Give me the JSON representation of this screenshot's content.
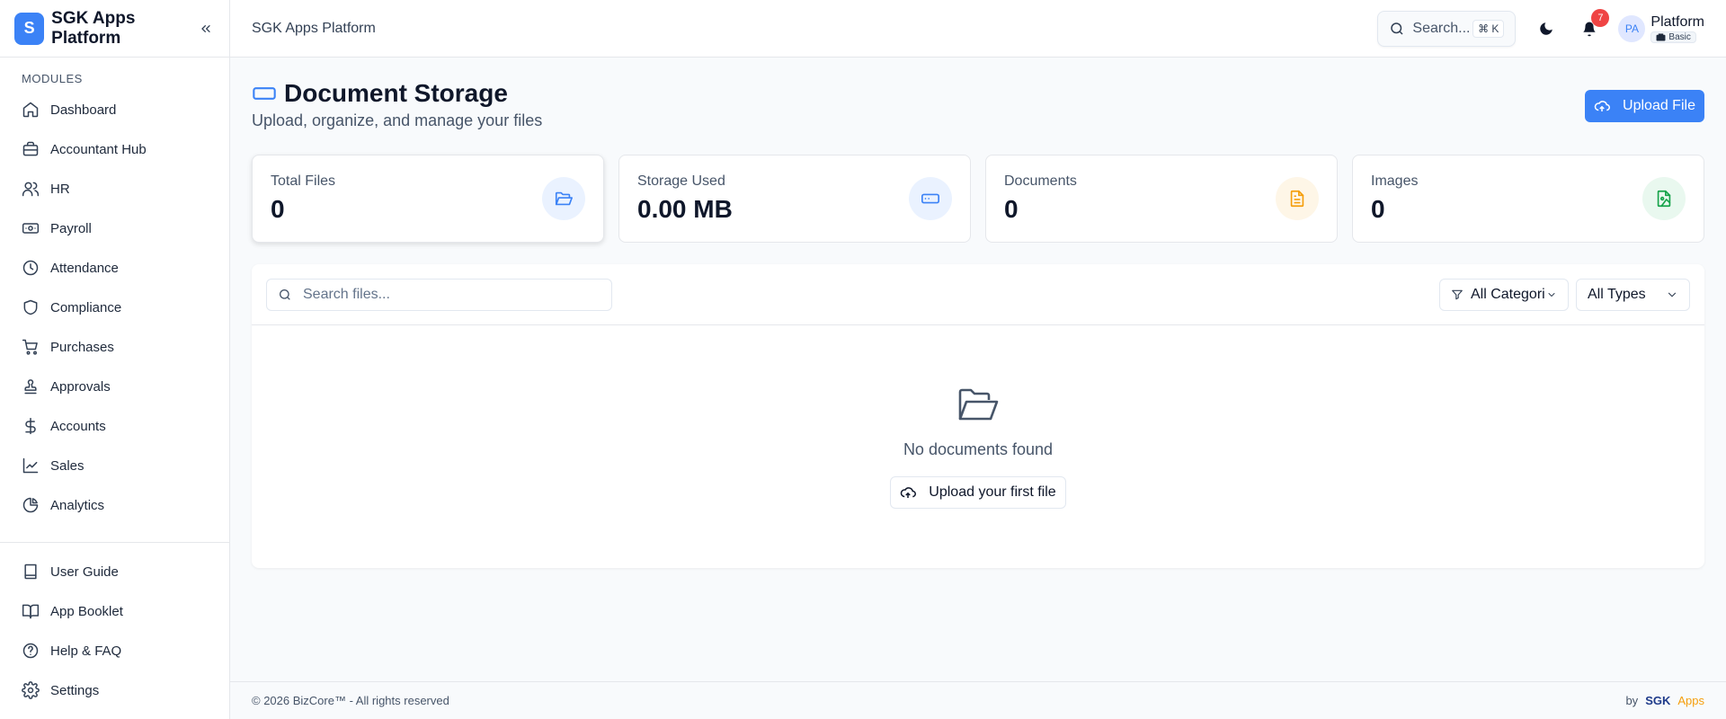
{
  "brand": {
    "logo_letter": "S",
    "name": "SGK Apps Platform"
  },
  "sidebar": {
    "section_label": "MODULES",
    "items": [
      {
        "label": "Dashboard",
        "icon": "home-icon"
      },
      {
        "label": "Accountant Hub",
        "icon": "briefcase-icon"
      },
      {
        "label": "HR",
        "icon": "users-icon"
      },
      {
        "label": "Payroll",
        "icon": "banknote-icon"
      },
      {
        "label": "Attendance",
        "icon": "clock-icon"
      },
      {
        "label": "Compliance",
        "icon": "shield-icon"
      },
      {
        "label": "Purchases",
        "icon": "cart-icon"
      },
      {
        "label": "Approvals",
        "icon": "stamp-icon"
      },
      {
        "label": "Accounts",
        "icon": "dollar-icon"
      },
      {
        "label": "Sales",
        "icon": "trending-up-icon"
      },
      {
        "label": "Analytics",
        "icon": "pie-chart-icon"
      }
    ],
    "bottom_items": [
      {
        "label": "User Guide",
        "icon": "book-icon"
      },
      {
        "label": "App Booklet",
        "icon": "book-open-icon"
      },
      {
        "label": "Help & FAQ",
        "icon": "help-circle-icon"
      },
      {
        "label": "Settings",
        "icon": "settings-icon"
      }
    ]
  },
  "header": {
    "breadcrumb": "SGK Apps Platform",
    "search_label": "Search...",
    "search_shortcut": "⌘ K",
    "notification_count": "7",
    "user_initials": "PA",
    "user_name": "Platform",
    "plan": "Basic"
  },
  "page": {
    "title": "Document Storage",
    "subtitle": "Upload, organize, and manage your files",
    "upload_label": "Upload File"
  },
  "stats": [
    {
      "label": "Total Files",
      "value": "0",
      "icon": "folder-open-icon",
      "color": "#3b82f6",
      "bg": "#eaf2ff"
    },
    {
      "label": "Storage Used",
      "value": "0.00 MB",
      "icon": "hard-drive-icon",
      "color": "#3b82f6",
      "bg": "#eaf2ff"
    },
    {
      "label": "Documents",
      "value": "0",
      "icon": "file-text-icon",
      "color": "#f59e0b",
      "bg": "#fef6e7"
    },
    {
      "label": "Images",
      "value": "0",
      "icon": "file-image-icon",
      "color": "#16a34a",
      "bg": "#e9f8ef"
    }
  ],
  "files": {
    "search_placeholder": "Search files...",
    "category_filter": "All Categories",
    "type_filter": "All Types",
    "empty_message": "No documents found",
    "empty_action": "Upload your first file"
  },
  "footer": {
    "copyright": "© 2026 BizCore™ - All rights reserved",
    "by": "by",
    "brand_a": "SGK",
    "brand_b": "Apps"
  }
}
